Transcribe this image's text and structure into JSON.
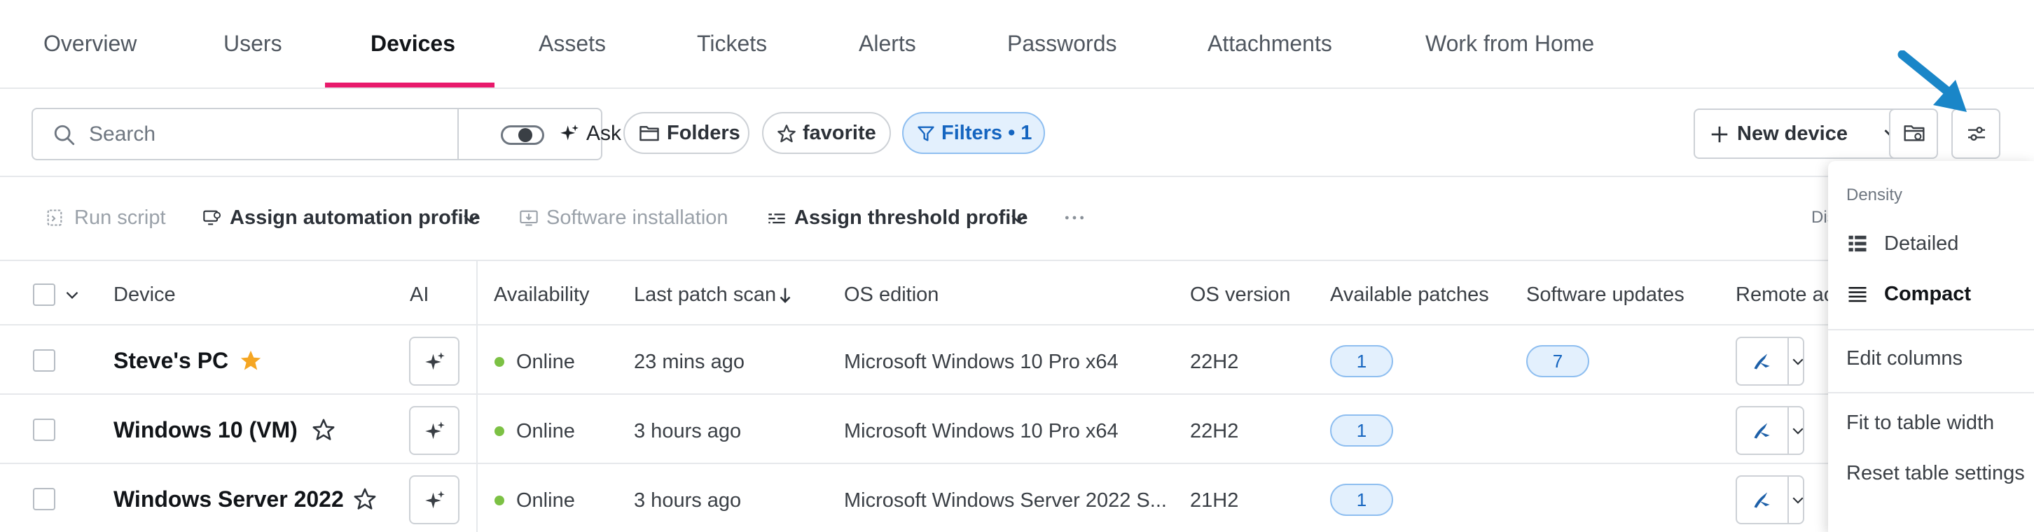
{
  "tabs": [
    {
      "label": "Overview"
    },
    {
      "label": "Users"
    },
    {
      "label": "Devices"
    },
    {
      "label": "Assets"
    },
    {
      "label": "Tickets"
    },
    {
      "label": "Alerts"
    },
    {
      "label": "Passwords"
    },
    {
      "label": "Attachments"
    },
    {
      "label": "Work from Home"
    }
  ],
  "active_tab": "Devices",
  "toolbar": {
    "search_placeholder": "Search",
    "ask_label": "Ask",
    "folders_label": "Folders",
    "favorite_label": "favorite",
    "filters_label": "Filters • 1",
    "new_device_label": "New device"
  },
  "actions": {
    "run_script": "Run script",
    "assign_automation_profile": "Assign automation profile",
    "software_installation": "Software installation",
    "assign_threshold_profile": "Assign threshold profile",
    "truncated_label": "Dis"
  },
  "table": {
    "columns": {
      "device": "Device",
      "ai": "AI",
      "availability": "Availability",
      "last_patch_scan": "Last patch scan",
      "os_edition": "OS edition",
      "os_version": "OS version",
      "available_patches": "Available patches",
      "software_updates": "Software updates",
      "remote_access": "Remote ac"
    },
    "rows": [
      {
        "device": "Steve's PC",
        "favorite": true,
        "availability": "Online",
        "last_patch_scan": "23 mins ago",
        "os_edition": "Microsoft Windows 10 Pro x64",
        "os_version": "22H2",
        "available_patches": "1",
        "software_updates": "7"
      },
      {
        "device": "Windows 10 (VM)",
        "favorite": false,
        "availability": "Online",
        "last_patch_scan": "3 hours ago",
        "os_edition": "Microsoft Windows 10 Pro x64",
        "os_version": "22H2",
        "available_patches": "1",
        "software_updates": ""
      },
      {
        "device": "Windows Server 2022",
        "favorite": false,
        "availability": "Online",
        "last_patch_scan": "3 hours ago",
        "os_edition": "Microsoft Windows Server 2022 S...",
        "os_version": "21H2",
        "available_patches": "1",
        "software_updates": ""
      }
    ]
  },
  "menu": {
    "section_label": "Density",
    "detailed": "Detailed",
    "compact": "Compact",
    "selected": "Compact",
    "edit_columns": "Edit columns",
    "fit_to_table_width": "Fit to table width",
    "reset_table_settings": "Reset table settings"
  },
  "colors": {
    "accent_tab": "#e8196b",
    "filter_blue": "#1565c0",
    "online_green": "#7cc144",
    "favorite_star": "#f5a623",
    "annotation_arrow": "#1a86c8"
  }
}
